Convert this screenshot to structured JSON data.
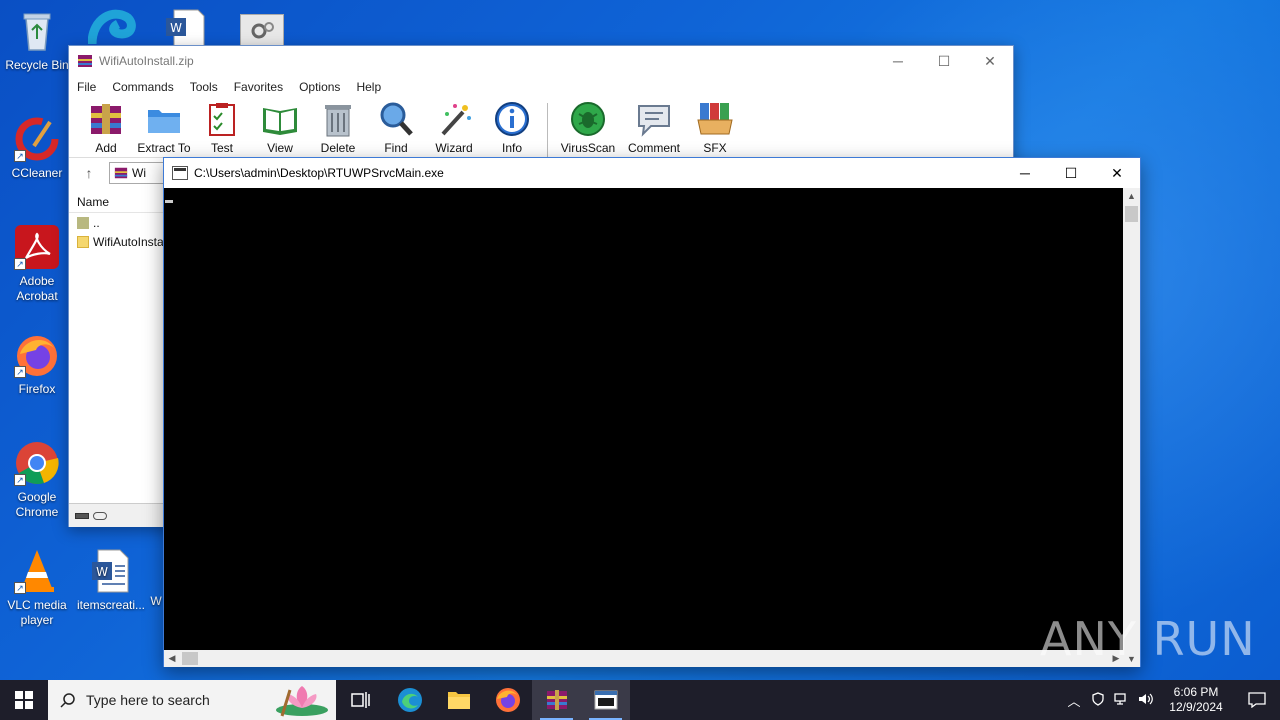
{
  "desktop": {
    "icons": [
      {
        "label": "Recycle Bin",
        "icon": "recycle-bin-icon"
      },
      {
        "label": "CCleaner",
        "icon": "ccleaner-icon"
      },
      {
        "label": "Adobe Acrobat",
        "icon": "adobe-acrobat-icon"
      },
      {
        "label": "Firefox",
        "icon": "firefox-icon"
      },
      {
        "label": "Google Chrome",
        "icon": "chrome-icon"
      },
      {
        "label": "VLC media player",
        "icon": "vlc-icon"
      },
      {
        "label": "itemscreati...",
        "icon": "word-document-icon"
      },
      {
        "label": "W",
        "icon": "word-document-icon"
      }
    ]
  },
  "winrar": {
    "title": "WifiAutoInstall.zip",
    "menu": [
      "File",
      "Commands",
      "Tools",
      "Favorites",
      "Options",
      "Help"
    ],
    "toolbar": [
      {
        "label": "Add",
        "icon": "add-archive-icon"
      },
      {
        "label": "Extract To",
        "icon": "extract-folder-icon"
      },
      {
        "label": "Test",
        "icon": "test-clipboard-icon"
      },
      {
        "label": "View",
        "icon": "view-book-icon"
      },
      {
        "label": "Delete",
        "icon": "trash-icon"
      },
      {
        "label": "Find",
        "icon": "magnifier-icon"
      },
      {
        "label": "Wizard",
        "icon": "wand-icon"
      },
      {
        "label": "Info",
        "icon": "info-icon"
      },
      {
        "label": "VirusScan",
        "icon": "virus-scan-icon"
      },
      {
        "label": "Comment",
        "icon": "comment-icon"
      },
      {
        "label": "SFX",
        "icon": "sfx-icon"
      }
    ],
    "address": "Wi",
    "list_header": "Name",
    "rows": [
      "..",
      "WifiAutoInsta"
    ]
  },
  "console": {
    "title": "C:\\Users\\admin\\Desktop\\RTUWPSrvcMain.exe"
  },
  "watermark": "ANY RUN",
  "taskbar": {
    "search_placeholder": "Type here to search",
    "time": "6:06 PM",
    "date": "12/9/2024"
  },
  "colors": {
    "desktop": "#0f63d6",
    "taskbar": "#1e1e2a",
    "console_bg": "#000000",
    "accent": "#7ab4ff"
  }
}
